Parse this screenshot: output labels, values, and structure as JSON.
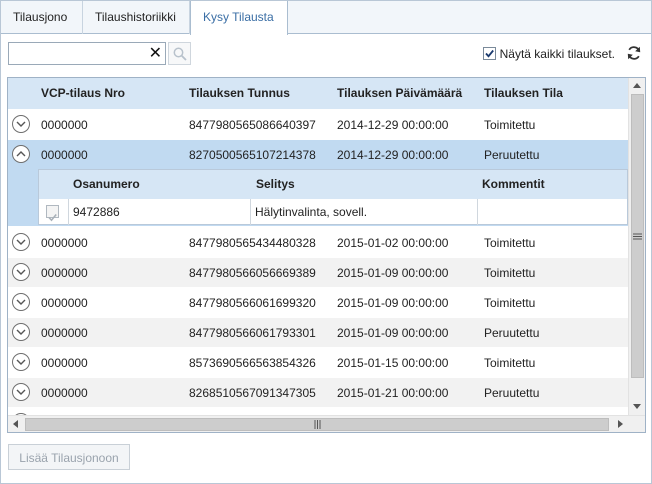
{
  "tabs": [
    {
      "label": "Tilausjono"
    },
    {
      "label": "Tilaushistoriikki"
    },
    {
      "label": "Kysy Tilausta"
    }
  ],
  "toolbar": {
    "search_value": "",
    "clear_symbol": "✕",
    "show_all_label": "Näytä kaikki tilaukset.",
    "show_all_checked": true
  },
  "grid": {
    "columns": [
      "VCP-tilaus Nro",
      "Tilauksen Tunnus",
      "Tilauksen Päivämäärä",
      "Tilauksen Tila"
    ],
    "rows": [
      {
        "nro": "0000000",
        "tunnus": "8477980565086640397",
        "pvm": "2014-12-29 00:00:00",
        "tila": "Toimitettu"
      },
      {
        "nro": "0000000",
        "tunnus": "8270500565107214378",
        "pvm": "2014-12-29 00:00:00",
        "tila": "Peruutettu"
      },
      {
        "nro": "0000000",
        "tunnus": "8477980565434480328",
        "pvm": "2015-01-02 00:00:00",
        "tila": "Toimitettu"
      },
      {
        "nro": "0000000",
        "tunnus": "8477980566056669389",
        "pvm": "2015-01-09 00:00:00",
        "tila": "Toimitettu"
      },
      {
        "nro": "0000000",
        "tunnus": "8477980566061699320",
        "pvm": "2015-01-09 00:00:00",
        "tila": "Toimitettu"
      },
      {
        "nro": "0000000",
        "tunnus": "8477980566061793301",
        "pvm": "2015-01-09 00:00:00",
        "tila": "Peruutettu"
      },
      {
        "nro": "0000000",
        "tunnus": "8573690566563854326",
        "pvm": "2015-01-15 00:00:00",
        "tila": "Toimitettu"
      },
      {
        "nro": "0000000",
        "tunnus": "8268510567091347305",
        "pvm": "2015-01-21 00:00:00",
        "tila": "Peruutettu"
      }
    ],
    "detail": {
      "columns": [
        "Osanumero",
        "Selitys",
        "Kommentit"
      ],
      "row": {
        "osanumero": "9472886",
        "selitys": "Hälytinvalinta, sovell.",
        "kommentit": ""
      }
    }
  },
  "footer": {
    "add_button_label": "Lisää Tilausjonoon"
  },
  "colors": {
    "header_bg": "#d6e6f5",
    "selected_row": "#c1daf1",
    "active_tab_text": "#3a6ea5"
  }
}
